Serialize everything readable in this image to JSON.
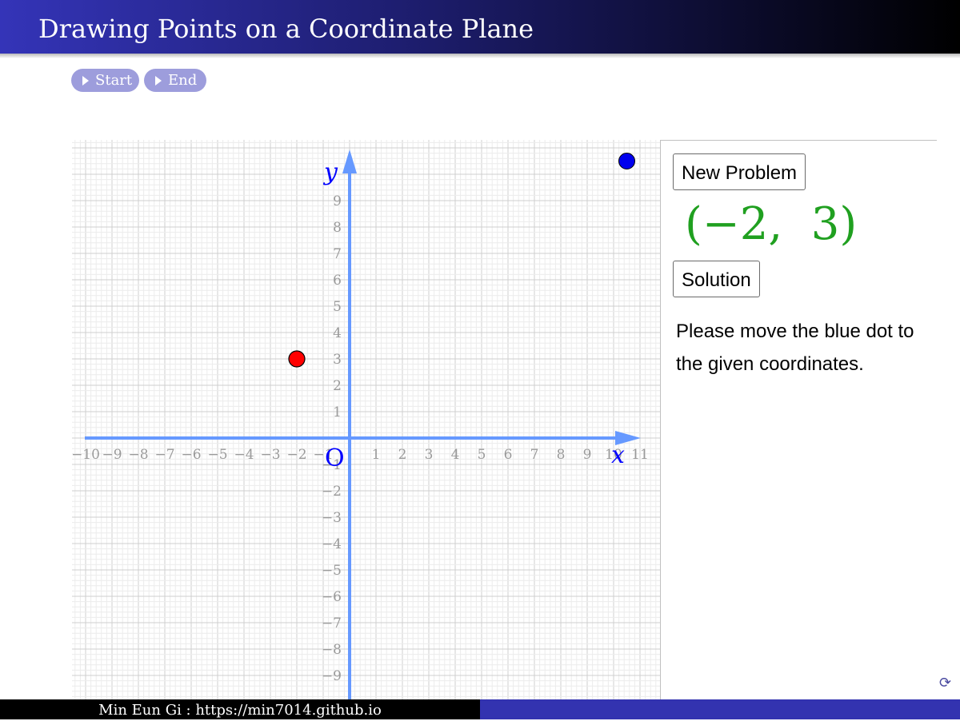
{
  "header": {
    "title": "Drawing Points on a Coordinate Plane"
  },
  "nav": {
    "start_label": "Start",
    "end_label": "End"
  },
  "graph": {
    "x_axis_label": "x",
    "y_axis_label": "y",
    "origin_label": "O",
    "x_ticks": [
      "−10",
      "−9",
      "−8",
      "−7",
      "−6",
      "−5",
      "−4",
      "−3",
      "−2",
      "−1",
      "1",
      "2",
      "3",
      "4",
      "5",
      "6",
      "7",
      "8",
      "9",
      "10",
      "11"
    ],
    "y_ticks": [
      "9",
      "8",
      "7",
      "6",
      "5",
      "4",
      "3",
      "2",
      "1",
      "−1",
      "−2",
      "−3",
      "−4",
      "−5",
      "−6",
      "−7",
      "−8",
      "−9"
    ],
    "red_point": {
      "x": -2,
      "y": 3,
      "color": "#ff0000"
    },
    "blue_point": {
      "x": 10.5,
      "y": 10.5,
      "color": "#0000ee"
    },
    "axis_color": "#6699ff"
  },
  "panel": {
    "new_problem_label": "New Problem",
    "coordinates": "(−2,  3)",
    "solution_label": "Solution",
    "instruction": "Please move the blue dot to the given coordinates.",
    "coordinates_color": "#20a020"
  },
  "footer": {
    "credit": "Min Eun Gi : https://min7014.github.io"
  },
  "icons": {
    "reset": "refresh-icon"
  }
}
